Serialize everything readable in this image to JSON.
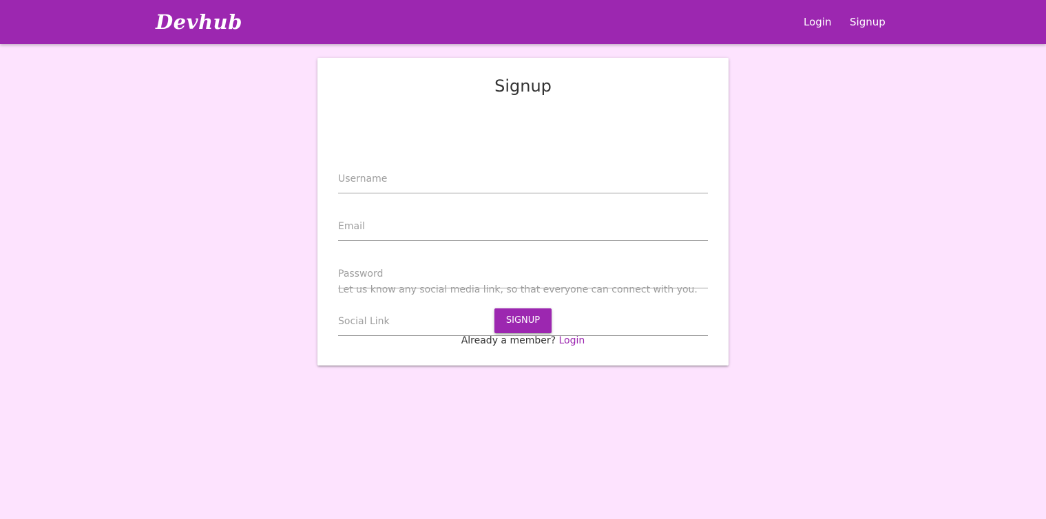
{
  "navbar": {
    "brand": "Devhub",
    "links": [
      {
        "label": "Login"
      },
      {
        "label": "Signup"
      }
    ]
  },
  "form": {
    "title": "Signup",
    "fields": [
      {
        "placeholder": "Username",
        "value": ""
      },
      {
        "placeholder": "Email",
        "value": ""
      },
      {
        "placeholder": "Password",
        "value": ""
      },
      {
        "placeholder": "Social Link",
        "value": ""
      }
    ],
    "helper_text": "Let us know any social media link, so that everyone can connect with you.",
    "submit_label": "SIGNUP",
    "member_text": "Already a member?",
    "login_link": "Login"
  },
  "colors": {
    "primary": "#9c27b0",
    "background": "#fde3fe",
    "card": "#ffffff",
    "muted_text": "#9e9e9e"
  }
}
